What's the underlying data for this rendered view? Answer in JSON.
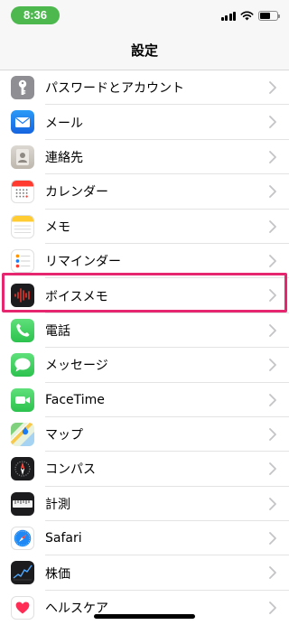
{
  "status_bar": {
    "time": "8:36",
    "time_pill_color": "#4cb84e",
    "icons": [
      "signal-icon",
      "wifi-icon",
      "battery-icon"
    ]
  },
  "nav": {
    "title": "設定"
  },
  "settings_items": [
    {
      "label": "パスワードとアカウント",
      "icon": "key-icon",
      "icon_color": "#8e8e93"
    },
    {
      "label": "メール",
      "icon": "envelope-icon",
      "icon_color": "#1e7cf2"
    },
    {
      "label": "連絡先",
      "icon": "contacts-icon",
      "icon_color": "#c9c4bc"
    },
    {
      "label": "カレンダー",
      "icon": "calendar-icon",
      "icon_color": "#ffffff"
    },
    {
      "label": "メモ",
      "icon": "notes-icon",
      "icon_color": "#ffffff"
    },
    {
      "label": "リマインダー",
      "icon": "reminders-icon",
      "icon_color": "#ffffff"
    },
    {
      "label": "ボイスメモ",
      "icon": "voice-memo-icon",
      "icon_color": "#1c1c1e"
    },
    {
      "label": "電話",
      "icon": "phone-icon",
      "icon_color": "#35c759"
    },
    {
      "label": "メッセージ",
      "icon": "message-bubble-icon",
      "icon_color": "#35c759",
      "highlighted": true
    },
    {
      "label": "FaceTime",
      "icon": "video-camera-icon",
      "icon_color": "#35c759"
    },
    {
      "label": "マップ",
      "icon": "maps-icon",
      "icon_color": "#6fce7a"
    },
    {
      "label": "コンパス",
      "icon": "compass-icon",
      "icon_color": "#1c1c1e"
    },
    {
      "label": "計測",
      "icon": "measure-icon",
      "icon_color": "#1c1c1e"
    },
    {
      "label": "Safari",
      "icon": "safari-icon",
      "icon_color": "#ffffff"
    },
    {
      "label": "株価",
      "icon": "stocks-icon",
      "icon_color": "#1c1c1e"
    },
    {
      "label": "ヘルスケア",
      "icon": "health-heart-icon",
      "icon_color": "#ffffff"
    }
  ],
  "highlight_color": "#e6266e"
}
